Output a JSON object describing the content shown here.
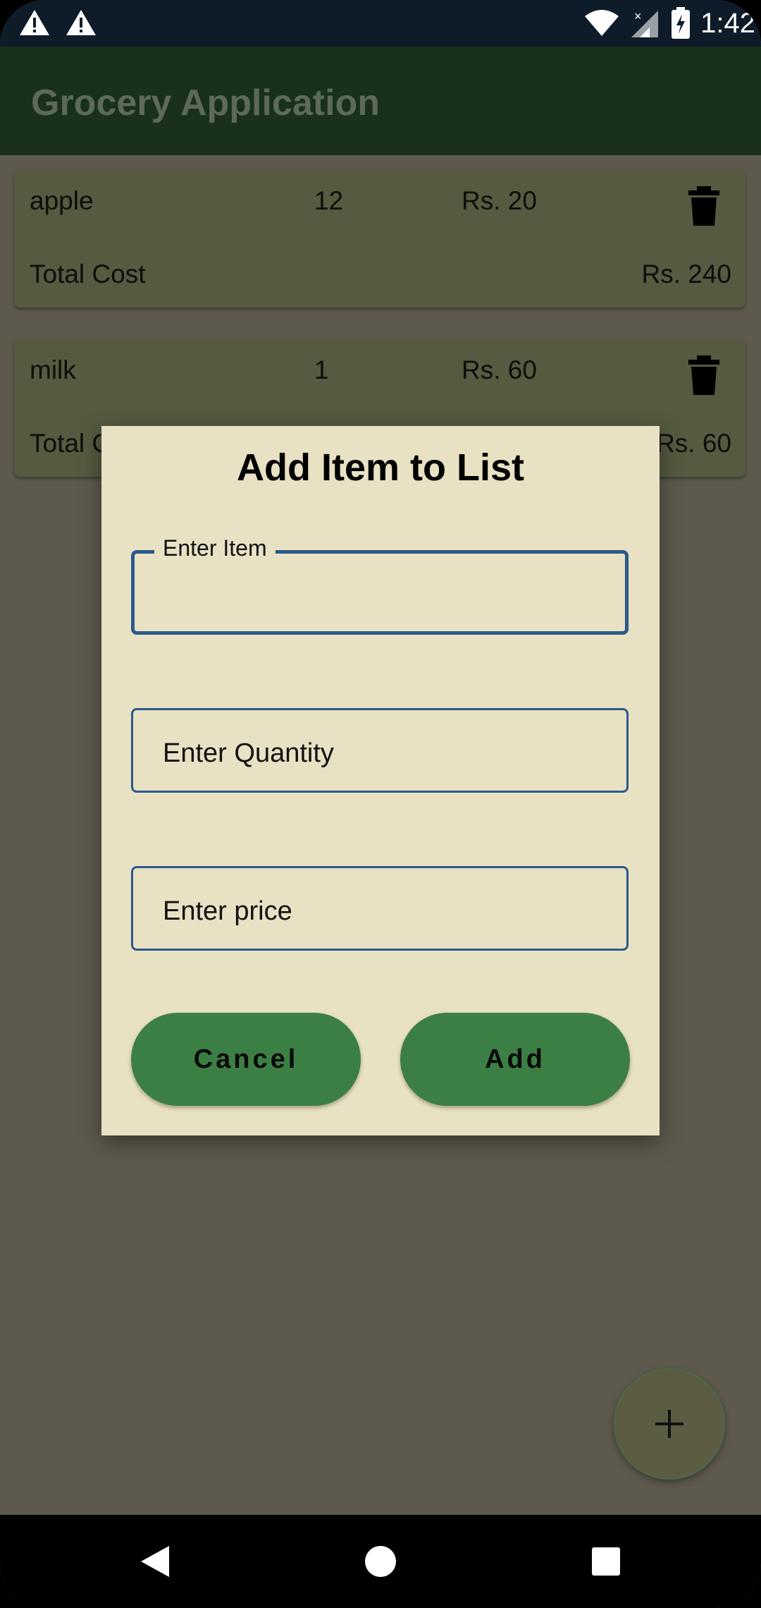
{
  "status_bar": {
    "time": "1:42",
    "left_icons": [
      "warning-icon",
      "warning-icon"
    ],
    "right_icons": [
      "wifi-icon",
      "signal-icon",
      "battery-charging-icon"
    ]
  },
  "app_bar": {
    "title": "Grocery Application"
  },
  "items": [
    {
      "name": "apple",
      "quantity": "12",
      "price": "Rs. 20",
      "total_label": "Total Cost",
      "total_value": "Rs. 240"
    },
    {
      "name": "milk",
      "quantity": "1",
      "price": "Rs. 60",
      "total_label": "Total Cost",
      "total_value": "Rs. 60"
    }
  ],
  "dialog": {
    "title": "Add Item to List",
    "item_field": {
      "label": "Enter Item",
      "value": ""
    },
    "quantity_field": {
      "placeholder": "Enter Quantity"
    },
    "price_field": {
      "placeholder": "Enter price"
    },
    "cancel_label": "Cancel",
    "add_label": "Add"
  },
  "fab": {
    "icon": "plus-icon"
  },
  "nav_bar": {
    "icons": [
      "back-icon",
      "home-icon",
      "recents-icon"
    ]
  },
  "colors": {
    "dialog_bg": "#e8e1c3",
    "button_bg": "#3c7f45",
    "field_border": "#2c5a8c"
  }
}
